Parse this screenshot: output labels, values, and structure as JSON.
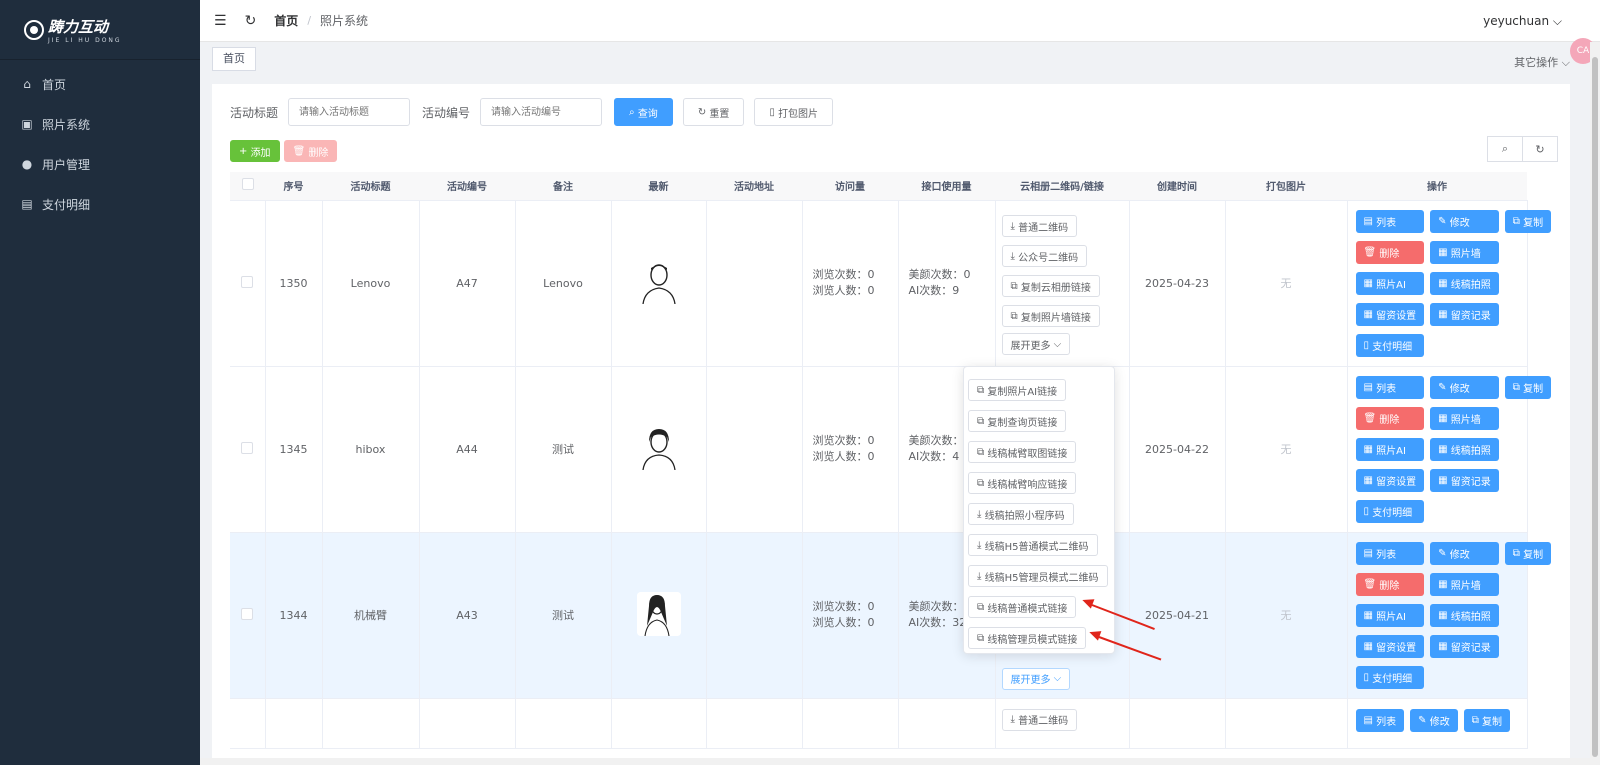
{
  "brand": {
    "name": "踌力互动",
    "sub": "JIE LI HU DONG"
  },
  "sidebar": {
    "items": [
      {
        "label": "首页",
        "icon": "home-icon"
      },
      {
        "label": "照片系统",
        "icon": "photo-icon"
      },
      {
        "label": "用户管理",
        "icon": "user-icon"
      },
      {
        "label": "支付明细",
        "icon": "clipboard-icon"
      }
    ]
  },
  "navbar": {
    "breadcrumb_home": "首页",
    "breadcrumb_sep": "/",
    "breadcrumb_current": "照片系统",
    "user": "yeyuchuan",
    "badge": "CA"
  },
  "tags": {
    "home": "首页",
    "other_ops": "其它操作"
  },
  "search": {
    "title_label": "活动标题",
    "title_placeholder": "请输入活动标题",
    "code_label": "活动编号",
    "code_placeholder": "请输入活动编号",
    "query": "查询",
    "reset": "重置",
    "pack": "打包图片"
  },
  "toolbar": {
    "add": "添加",
    "delete": "删除"
  },
  "table": {
    "headers": [
      "序号",
      "活动标题",
      "活动编号",
      "备注",
      "最新",
      "活动地址",
      "访问量",
      "接口使用量",
      "云相册二维码/链接",
      "创建时间",
      "打包图片",
      "操作"
    ],
    "rows": [
      {
        "id": "1350",
        "title": "Lenovo",
        "code": "A47",
        "note": "Lenovo",
        "visits1": "浏览次数：0",
        "visits2": "浏览人数：0",
        "api1": "美颜次数：0",
        "api2": "AI次数：9",
        "date": "2025-04-23",
        "pack": "无"
      },
      {
        "id": "1345",
        "title": "hibox",
        "code": "A44",
        "note": "测试",
        "visits1": "浏览次数：0",
        "visits2": "浏览人数：0",
        "api1": "美颜次数：0",
        "api2": "AI次数：4",
        "date": "2025-04-22",
        "pack": "无"
      },
      {
        "id": "1344",
        "title": "机械臂",
        "code": "A43",
        "note": "测试",
        "visits1": "浏览次数：0",
        "visits2": "浏览人数：0",
        "api1": "美颜次数：1",
        "api2": "AI次数：32",
        "date": "2025-04-21",
        "pack": "无"
      }
    ],
    "qr_buttons": [
      "普通二维码",
      "公众号二维码",
      "复制云相册链接",
      "复制照片墙链接"
    ],
    "expand": "展开更多",
    "ops": [
      "列表",
      "修改",
      "复制",
      "删除",
      "照片墙",
      "照片AI",
      "线稿拍照",
      "留资设置",
      "留资记录",
      "支付明细"
    ],
    "partial_qr": "普通二维码"
  },
  "dropdown": {
    "items": [
      {
        "label": "复制照片AI链接",
        "icon": "copy"
      },
      {
        "label": "复制查询页链接",
        "icon": "copy"
      },
      {
        "label": "线稿械臂取图链接",
        "icon": "copy"
      },
      {
        "label": "线稿械臂响应链接",
        "icon": "copy"
      },
      {
        "label": "线稿拍照小程序码",
        "icon": "download"
      },
      {
        "label": "线稿H5普通模式二维码",
        "icon": "download"
      },
      {
        "label": "线稿H5管理员模式二维码",
        "icon": "download"
      },
      {
        "label": "线稿普通模式链接",
        "icon": "copy"
      },
      {
        "label": "线稿管理员模式链接",
        "icon": "copy"
      }
    ]
  },
  "colors": {
    "sidebar": "#1f2d3d",
    "primary": "#409eff",
    "success": "#67c23a",
    "danger": "#f56c6c",
    "highlight": "#ecf5ff",
    "arrow": "#e0251b"
  }
}
